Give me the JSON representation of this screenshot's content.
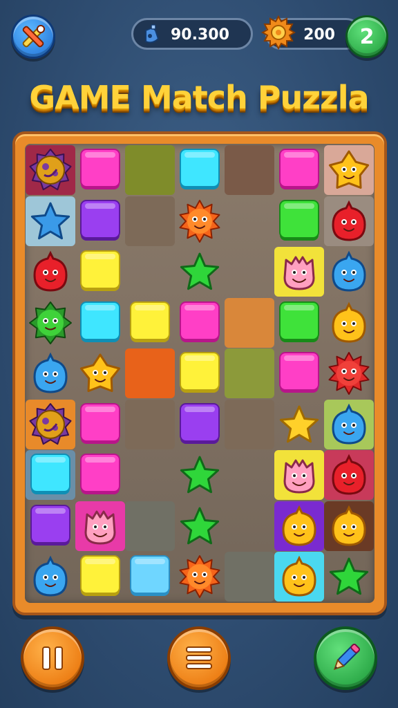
{
  "top_bar": {
    "score_value": "90.300",
    "coins_value": "200",
    "level_value": "2"
  },
  "title": "GAME Match Puzzla",
  "board": {
    "columns": 7,
    "rows": 9,
    "cells": [
      {
        "row": 0,
        "col": 0,
        "bg": "#a02848",
        "piece": "virus-purple-icon"
      },
      {
        "row": 0,
        "col": 1,
        "bg": null,
        "piece": "pink-block"
      },
      {
        "row": 0,
        "col": 2,
        "bg": "#7f8c2a",
        "piece": null
      },
      {
        "row": 0,
        "col": 3,
        "bg": null,
        "piece": "cyan-block"
      },
      {
        "row": 0,
        "col": 4,
        "bg": "#7a5a48",
        "piece": null
      },
      {
        "row": 0,
        "col": 5,
        "bg": null,
        "piece": "pink-block"
      },
      {
        "row": 0,
        "col": 6,
        "bg": "#d9a898",
        "piece": "yellow-star-creature-icon"
      },
      {
        "row": 1,
        "col": 0,
        "bg": "#9ec6d8",
        "piece": "blue-star-icon"
      },
      {
        "row": 1,
        "col": 1,
        "bg": null,
        "piece": "purple-block"
      },
      {
        "row": 1,
        "col": 2,
        "bg": "#7d6a58",
        "piece": null
      },
      {
        "row": 1,
        "col": 3,
        "bg": null,
        "piece": "orange-sun-creature-icon"
      },
      {
        "row": 1,
        "col": 4,
        "bg": null,
        "piece": null
      },
      {
        "row": 1,
        "col": 5,
        "bg": null,
        "piece": "green-block"
      },
      {
        "row": 1,
        "col": 6,
        "bg": "#9a8c80",
        "piece": "red-blob-icon"
      },
      {
        "row": 2,
        "col": 0,
        "bg": null,
        "piece": "red-blob-icon"
      },
      {
        "row": 2,
        "col": 1,
        "bg": null,
        "piece": "yellow-block"
      },
      {
        "row": 2,
        "col": 2,
        "bg": null,
        "piece": null
      },
      {
        "row": 2,
        "col": 3,
        "bg": null,
        "piece": "green-star-icon"
      },
      {
        "row": 2,
        "col": 4,
        "bg": null,
        "piece": null
      },
      {
        "row": 2,
        "col": 5,
        "bg": "#f2e23a",
        "piece": "pink-monster-icon"
      },
      {
        "row": 2,
        "col": 6,
        "bg": null,
        "piece": "blue-blob-icon"
      },
      {
        "row": 3,
        "col": 0,
        "bg": null,
        "piece": "green-virus-icon"
      },
      {
        "row": 3,
        "col": 1,
        "bg": null,
        "piece": "cyan-block"
      },
      {
        "row": 3,
        "col": 2,
        "bg": null,
        "piece": "yellow-block"
      },
      {
        "row": 3,
        "col": 3,
        "bg": null,
        "piece": "pink-block"
      },
      {
        "row": 3,
        "col": 4,
        "bg": "#d9873a",
        "piece": null
      },
      {
        "row": 3,
        "col": 5,
        "bg": null,
        "piece": "green-block"
      },
      {
        "row": 3,
        "col": 6,
        "bg": null,
        "piece": "yellow-blob-icon"
      },
      {
        "row": 4,
        "col": 0,
        "bg": null,
        "piece": "blue-blob-icon"
      },
      {
        "row": 4,
        "col": 1,
        "bg": null,
        "piece": "yellow-star-creature-icon"
      },
      {
        "row": 4,
        "col": 2,
        "bg": "#e8621a",
        "piece": null
      },
      {
        "row": 4,
        "col": 3,
        "bg": null,
        "piece": "yellow-block"
      },
      {
        "row": 4,
        "col": 4,
        "bg": "#8c9a3a",
        "piece": null
      },
      {
        "row": 4,
        "col": 5,
        "bg": null,
        "piece": "pink-block"
      },
      {
        "row": 4,
        "col": 6,
        "bg": null,
        "piece": "red-sun-creature-icon"
      },
      {
        "row": 5,
        "col": 0,
        "bg": "#e88a2a",
        "piece": "virus-purple-icon"
      },
      {
        "row": 5,
        "col": 1,
        "bg": null,
        "piece": "pink-block"
      },
      {
        "row": 5,
        "col": 2,
        "bg": "#7d6a58",
        "piece": null
      },
      {
        "row": 5,
        "col": 3,
        "bg": null,
        "piece": "purple-block"
      },
      {
        "row": 5,
        "col": 4,
        "bg": "#7d6a58",
        "piece": null
      },
      {
        "row": 5,
        "col": 5,
        "bg": null,
        "piece": "gold-star-icon"
      },
      {
        "row": 5,
        "col": 6,
        "bg": "#a8c85a",
        "piece": "blue-blob-icon"
      },
      {
        "row": 6,
        "col": 0,
        "bg": "#6a8fa8",
        "piece": "cyan-block"
      },
      {
        "row": 6,
        "col": 1,
        "bg": null,
        "piece": "pink-block"
      },
      {
        "row": 6,
        "col": 2,
        "bg": null,
        "piece": null
      },
      {
        "row": 6,
        "col": 3,
        "bg": null,
        "piece": "green-star-icon"
      },
      {
        "row": 6,
        "col": 4,
        "bg": null,
        "piece": null
      },
      {
        "row": 6,
        "col": 5,
        "bg": "#f2e23a",
        "piece": "pink-monster-icon"
      },
      {
        "row": 6,
        "col": 6,
        "bg": "#c83a5a",
        "piece": "red-blob-icon"
      },
      {
        "row": 7,
        "col": 0,
        "bg": null,
        "piece": "purple-block"
      },
      {
        "row": 7,
        "col": 1,
        "bg": "#e83aa8",
        "piece": "pink-monster-icon"
      },
      {
        "row": 7,
        "col": 2,
        "bg": "#707065",
        "piece": null
      },
      {
        "row": 7,
        "col": 3,
        "bg": null,
        "piece": "green-star-icon"
      },
      {
        "row": 7,
        "col": 4,
        "bg": null,
        "piece": null
      },
      {
        "row": 7,
        "col": 5,
        "bg": "#7a2ad0",
        "piece": "yellow-blob-icon"
      },
      {
        "row": 7,
        "col": 6,
        "bg": "#6a3a25",
        "piece": "yellow-blob-icon"
      },
      {
        "row": 8,
        "col": 0,
        "bg": null,
        "piece": "blue-blob-icon"
      },
      {
        "row": 8,
        "col": 1,
        "bg": null,
        "piece": "yellow-block"
      },
      {
        "row": 8,
        "col": 2,
        "bg": null,
        "piece": "lightblue-block"
      },
      {
        "row": 8,
        "col": 3,
        "bg": null,
        "piece": "orange-sun-creature-icon"
      },
      {
        "row": 8,
        "col": 4,
        "bg": "#707065",
        "piece": null
      },
      {
        "row": 8,
        "col": 5,
        "bg": "#4ad8f0",
        "piece": "yellow-blob-icon"
      },
      {
        "row": 8,
        "col": 6,
        "bg": null,
        "piece": "green-star-icon"
      }
    ]
  },
  "buttons": {
    "tool": "wrench-icon",
    "pause": "pause-icon",
    "menu": "menu-icon",
    "pencil": "pencil-icon"
  },
  "colors": {
    "background": "#2e4c70",
    "title": "#ffd23a",
    "frame": "#e98b2a",
    "blue_button": "#1f6ed4",
    "green_button": "#1d9a38",
    "orange_button": "#e66a00"
  }
}
